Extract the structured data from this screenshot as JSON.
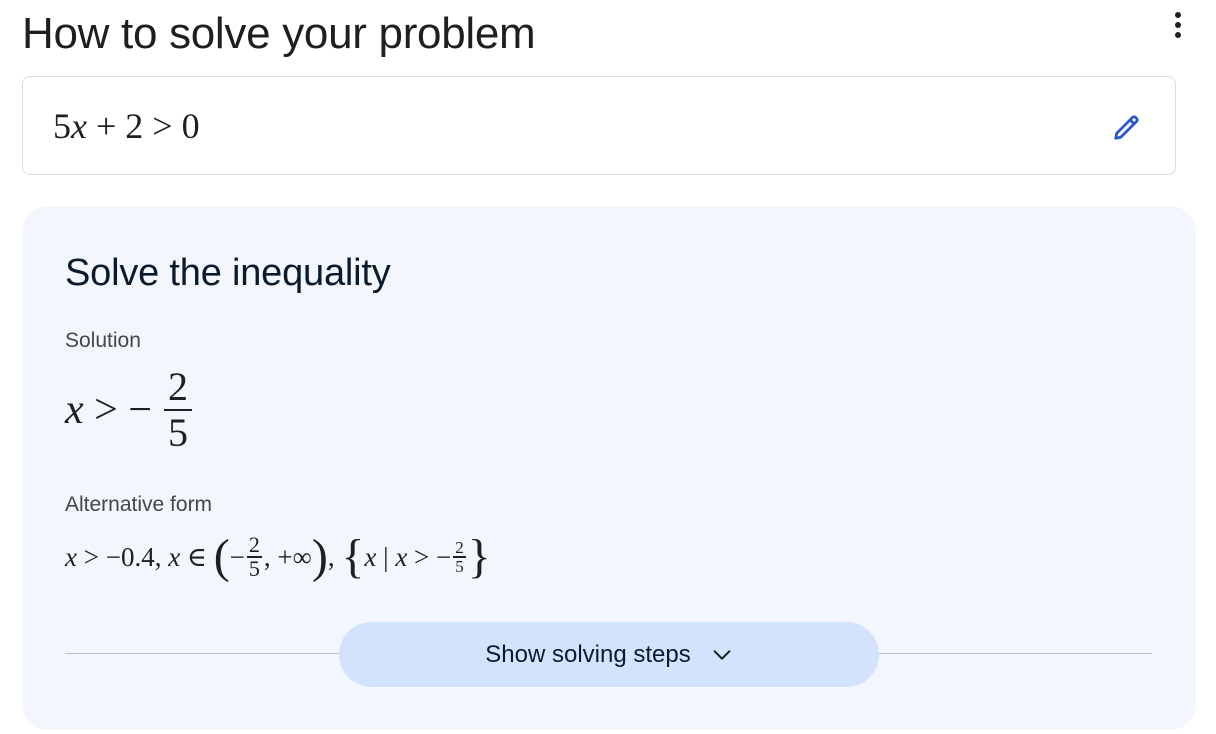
{
  "header": {
    "title": "How to solve your problem",
    "menu_icon": "more-vert-icon"
  },
  "problem": {
    "expression_parts": [
      "5",
      "x",
      " + 2 > 0"
    ],
    "edit_icon": "pencil-icon",
    "accent_color": "#2b55c8"
  },
  "solution_card": {
    "title": "Solve the inequality",
    "solution_label": "Solution",
    "solution": {
      "var": "x",
      "operator": " > −",
      "numerator": "2",
      "denominator": "5"
    },
    "alternative_label": "Alternative form",
    "alternative": {
      "part1_var": "x",
      "part1_rest": " > −0.4, ",
      "part2_var": "x",
      "part2_rest": " ∈ ",
      "interval_open": "(",
      "interval_minus": "−",
      "interval_num": "2",
      "interval_den": "5",
      "interval_rest": ", +∞",
      "interval_close": ")",
      "separator": ", ",
      "set_open": "{",
      "set_var": "x",
      "set_bar": " | ",
      "set_var2": "x",
      "set_op": " > −",
      "set_num": "2",
      "set_den": "5",
      "set_close": "}"
    },
    "steps_button_label": "Show solving steps",
    "steps_button_icon": "chevron-down-icon",
    "card_color": "#f3f6fc",
    "button_color": "#d3e3fd"
  }
}
